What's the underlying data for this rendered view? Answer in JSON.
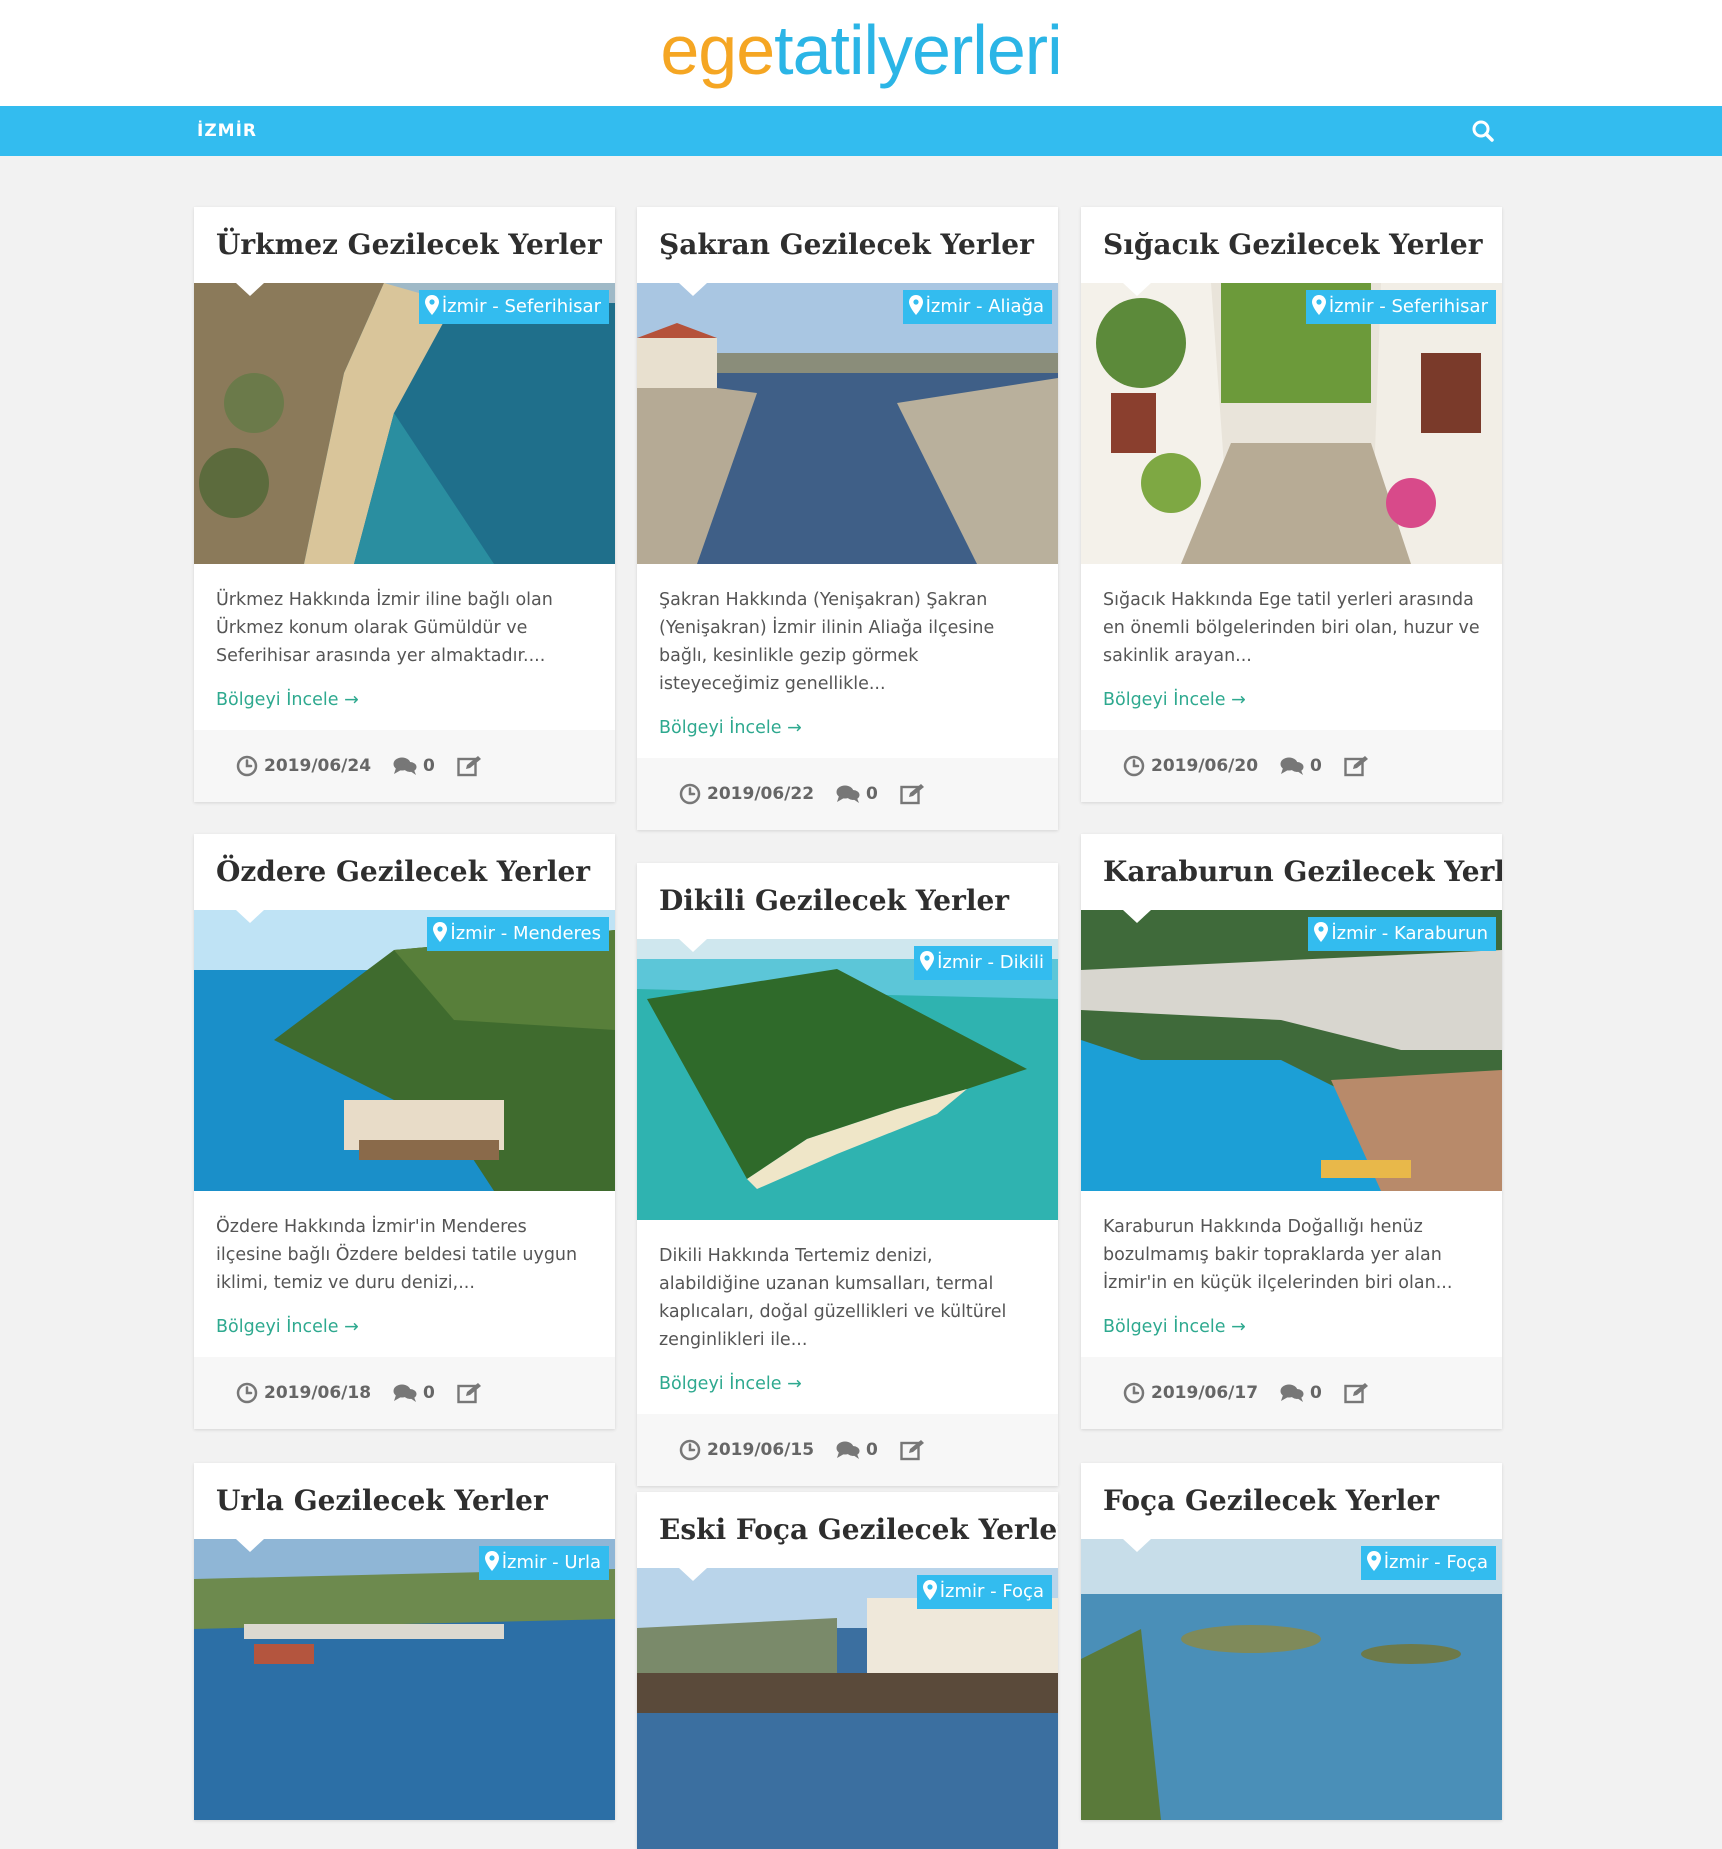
{
  "brand": {
    "logo_part1": "ege",
    "logo_part2": "tatilyerleri"
  },
  "nav": {
    "item": "İZMİR",
    "search_icon": "search-icon"
  },
  "more_label": "Bölgeyi İncele →",
  "colors": {
    "accent": "#33bcef",
    "link": "#2ea98f",
    "logo_orange": "#f5a623",
    "logo_blue": "#2bb5e6"
  },
  "cards": [
    {
      "title": "Ürkmez Gezilecek Yerler",
      "location": "İzmir - Seferihisar",
      "excerpt": "Ürkmez Hakkında İzmir iline bağlı olan Ürkmez konum olarak Gümüldür ve Seferihisar arasında yer almaktadır....",
      "date": "2019/06/24",
      "comments": "0"
    },
    {
      "title": "Şakran Gezilecek Yerler",
      "location": "İzmir - Aliağa",
      "excerpt": "Şakran Hakkında (Yenişakran) Şakran (Yenişakran) İzmir ilinin Aliağa ilçesine bağlı, kesinlikle gezip görmek isteyeceğimiz genellikle...",
      "date": "2019/06/22",
      "comments": "0"
    },
    {
      "title": "Sığacık Gezilecek Yerler",
      "location": "İzmir - Seferihisar",
      "excerpt": "Sığacık Hakkında Ege tatil yerleri arasında en önemli bölgelerinden biri olan, huzur ve sakinlik arayan...",
      "date": "2019/06/20",
      "comments": "0"
    },
    {
      "title": "Özdere Gezilecek Yerler",
      "location": "İzmir - Menderes",
      "excerpt": "Özdere Hakkında İzmir'in Menderes ilçesine bağlı Özdere beldesi tatile uygun iklimi, temiz ve duru denizi,...",
      "date": "2019/06/18",
      "comments": "0"
    },
    {
      "title": "Dikili Gezilecek Yerler",
      "location": "İzmir - Dikili",
      "excerpt": "Dikili Hakkında Tertemiz denizi, alabildiğine uzanan kumsalları, termal kaplıcaları, doğal güzellikleri ve kültürel zenginlikleri ile...",
      "date": "2019/06/15",
      "comments": "0"
    },
    {
      "title": "Karaburun Gezilecek Yerler",
      "location": "İzmir - Karaburun",
      "excerpt": "Karaburun Hakkında Doğallığı henüz bozulmamış bakir topraklarda yer alan İzmir'in en küçük ilçelerinden biri olan...",
      "date": "2019/06/17",
      "comments": "0"
    },
    {
      "title": "Urla Gezilecek Yerler",
      "location": "İzmir - Urla"
    },
    {
      "title": "Eski Foça Gezilecek Yerler",
      "location": "İzmir - Foça"
    },
    {
      "title": "Foça Gezilecek Yerler",
      "location": "İzmir - Foça"
    }
  ]
}
